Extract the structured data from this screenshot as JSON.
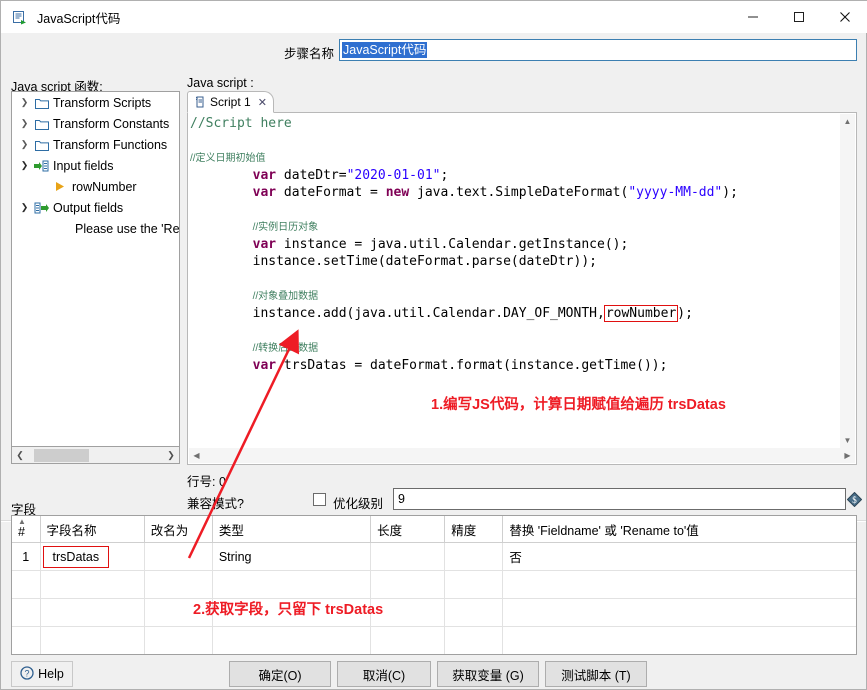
{
  "window": {
    "title": "JavaScript代码",
    "icon": "script-step-icon",
    "minimize": "minimize-icon",
    "maximize": "maximize-icon",
    "close": "close-icon"
  },
  "step": {
    "label": "步骤名称",
    "value": "JavaScript代码"
  },
  "panels": {
    "functions_caption": "Java script 函数:",
    "script_caption": "Java script :",
    "fields_caption": "字段"
  },
  "tree": {
    "items": [
      {
        "label": "Transform Scripts",
        "twisty": "collapsed",
        "icon": "folder-icon",
        "indent": 0
      },
      {
        "label": "Transform Constants",
        "twisty": "collapsed",
        "icon": "folder-icon",
        "indent": 0
      },
      {
        "label": "Transform Functions",
        "twisty": "collapsed",
        "icon": "folder-icon",
        "indent": 0
      },
      {
        "label": "Input fields",
        "twisty": "expanded",
        "icon": "input-fields-icon",
        "indent": 0
      },
      {
        "label": "rowNumber",
        "twisty": "none",
        "icon": "field-arrow-icon",
        "indent": 1
      },
      {
        "label": "Output fields",
        "twisty": "expanded",
        "icon": "output-fields-icon",
        "indent": 0
      },
      {
        "label": "Please use the 'Re",
        "twisty": "none",
        "icon": "none",
        "indent": 2
      }
    ]
  },
  "editor": {
    "tab": {
      "label": "Script 1",
      "icon": "script-icon",
      "close": "✕"
    },
    "code_lines": [
      "//Script here",
      "",
      "//定义日期初始值",
      "        var dateDtr=\"2020-01-01\";",
      "        var dateFormat = new java.text.SimpleDateFormat(\"yyyy-MM-dd\");",
      "",
      "        //实例日历对象",
      "        var instance = java.util.Calendar.getInstance();",
      "        instance.setTime(dateFormat.parse(dateDtr));",
      "",
      "        //对象叠加数据",
      "        instance.add(java.util.Calendar.DAY_OF_MONTH,rowNumber);",
      "",
      "        //转换后的数据",
      "        var trsDatas = dateFormat.format(instance.getTime());"
    ],
    "highlighted_token": "rowNumber"
  },
  "status": {
    "lineno": "行号: 0",
    "compat": "兼容模式?",
    "optlevel_label": "优化级别",
    "optlevel_value": "9",
    "optlevel_checked": false,
    "opt_icon": "variable-icon"
  },
  "annotations": [
    {
      "id": "annot1",
      "text": "1.编写JS代码，计算日期赋值给遍历 trsDatas",
      "color": "#ee1c25"
    },
    {
      "id": "annot2",
      "text": "2.获取字段，只留下 trsDatas",
      "color": "#ee1c25"
    }
  ],
  "fields_table": {
    "columns": [
      "#",
      "字段名称",
      "改名为",
      "类型",
      "长度",
      "精度",
      "替换 'Fieldname' 或 'Rename to'值"
    ],
    "rows": [
      {
        "num": "1",
        "name": "trsDatas",
        "rename": "",
        "type": "String",
        "length": "",
        "precision": "",
        "replace": "否"
      },
      {
        "num": "",
        "name": "",
        "rename": "",
        "type": "",
        "length": "",
        "precision": "",
        "replace": ""
      },
      {
        "num": "",
        "name": "",
        "rename": "",
        "type": "",
        "length": "",
        "precision": "",
        "replace": ""
      },
      {
        "num": "",
        "name": "",
        "rename": "",
        "type": "",
        "length": "",
        "precision": "",
        "replace": ""
      }
    ]
  },
  "buttons": {
    "help": "Help",
    "ok": "确定(O)",
    "cancel": "取消(C)",
    "get_vars": "获取变量 (G)",
    "test_script": "测试脚本 (T)"
  }
}
